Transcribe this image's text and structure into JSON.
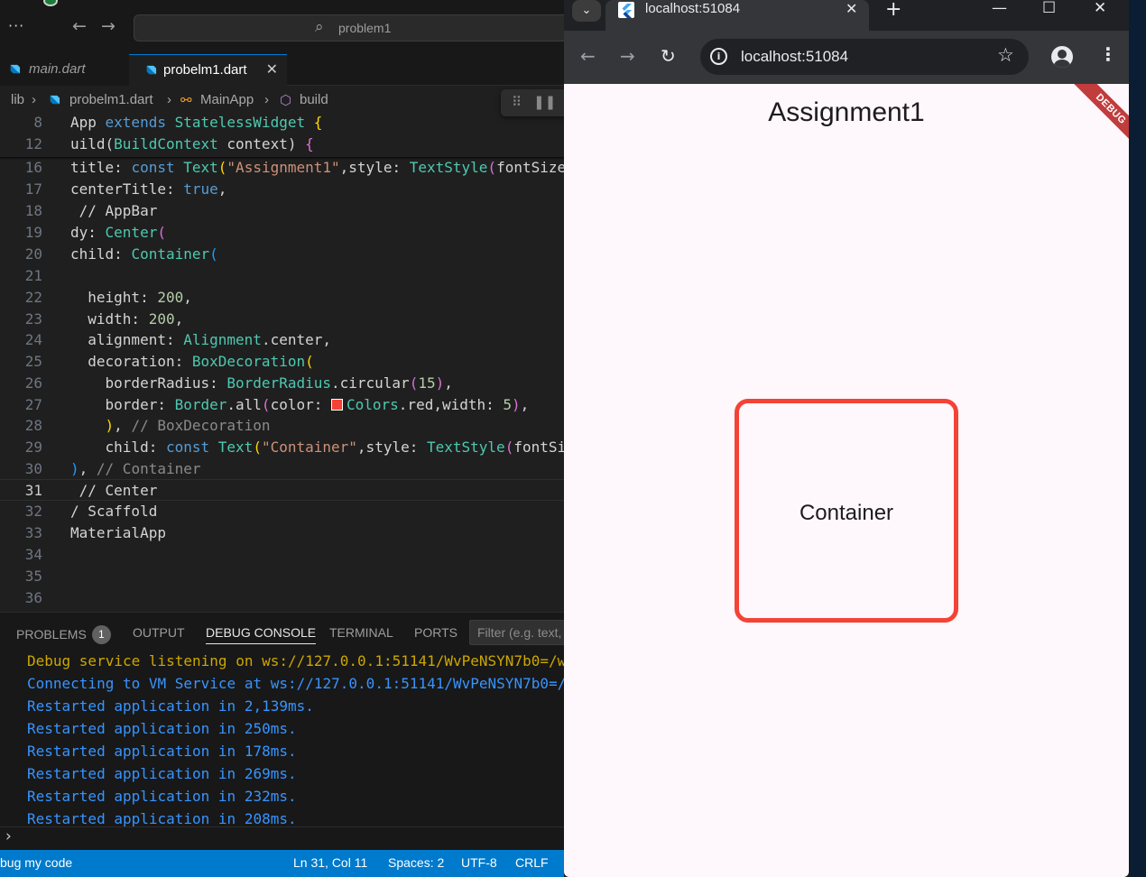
{
  "vscode": {
    "search_text": "problem1",
    "tabs": [
      {
        "label": "main.dart"
      },
      {
        "label": "probelm1.dart"
      }
    ],
    "breadcrumb": {
      "folder": "lib",
      "file": "probelm1.dart",
      "class": "MainApp",
      "method": "build"
    },
    "code_lines": [
      {
        "num": "8"
      },
      {
        "num": "12"
      },
      {
        "num": "16"
      },
      {
        "num": "17"
      },
      {
        "num": "18"
      },
      {
        "num": "19"
      },
      {
        "num": "20"
      },
      {
        "num": "21"
      },
      {
        "num": "22"
      },
      {
        "num": "23"
      },
      {
        "num": "24"
      },
      {
        "num": "25"
      },
      {
        "num": "26"
      },
      {
        "num": "27"
      },
      {
        "num": "28"
      },
      {
        "num": "29"
      },
      {
        "num": "30"
      },
      {
        "num": "31"
      },
      {
        "num": "32"
      },
      {
        "num": "33"
      },
      {
        "num": "34"
      },
      {
        "num": "35"
      },
      {
        "num": "36"
      }
    ],
    "panel": {
      "tabs": [
        "PROBLEMS",
        "OUTPUT",
        "DEBUG CONSOLE",
        "TERMINAL",
        "PORTS"
      ],
      "problems_count": "1",
      "filter_placeholder": "Filter (e.g. text,",
      "console_lines": [
        {
          "text": "Debug service listening on ws://127.0.0.1:51141/WvPeNSYN7b0=/w",
          "color": "#cca700"
        },
        {
          "text": "Connecting to VM Service at ws://127.0.0.1:51141/WvPeNSYN7b0=/",
          "color": "#3794ff"
        },
        {
          "text": "Restarted application in 2,139ms.",
          "color": "#3794ff"
        },
        {
          "text": "Restarted application in 250ms.",
          "color": "#3794ff"
        },
        {
          "text": "Restarted application in 178ms.",
          "color": "#3794ff"
        },
        {
          "text": "Restarted application in 269ms.",
          "color": "#3794ff"
        },
        {
          "text": "Restarted application in 232ms.",
          "color": "#3794ff"
        },
        {
          "text": "Restarted application in 208ms.",
          "color": "#3794ff"
        }
      ]
    },
    "statusbar": {
      "debug": "bug my code",
      "position": "Ln 31, Col 11",
      "spaces": "Spaces: 2",
      "encoding": "UTF-8",
      "eol": "CRLF"
    },
    "colors": {
      "statusbar": "#007acc",
      "accent": "#0078d4"
    }
  },
  "browser": {
    "tab_title": "localhost:51084",
    "url": "localhost:51084",
    "app": {
      "title": "Assignment1",
      "ribbon": "DEBUG",
      "container_text": "Container",
      "border_color": "#f44336",
      "background": "#fef7fb"
    }
  }
}
